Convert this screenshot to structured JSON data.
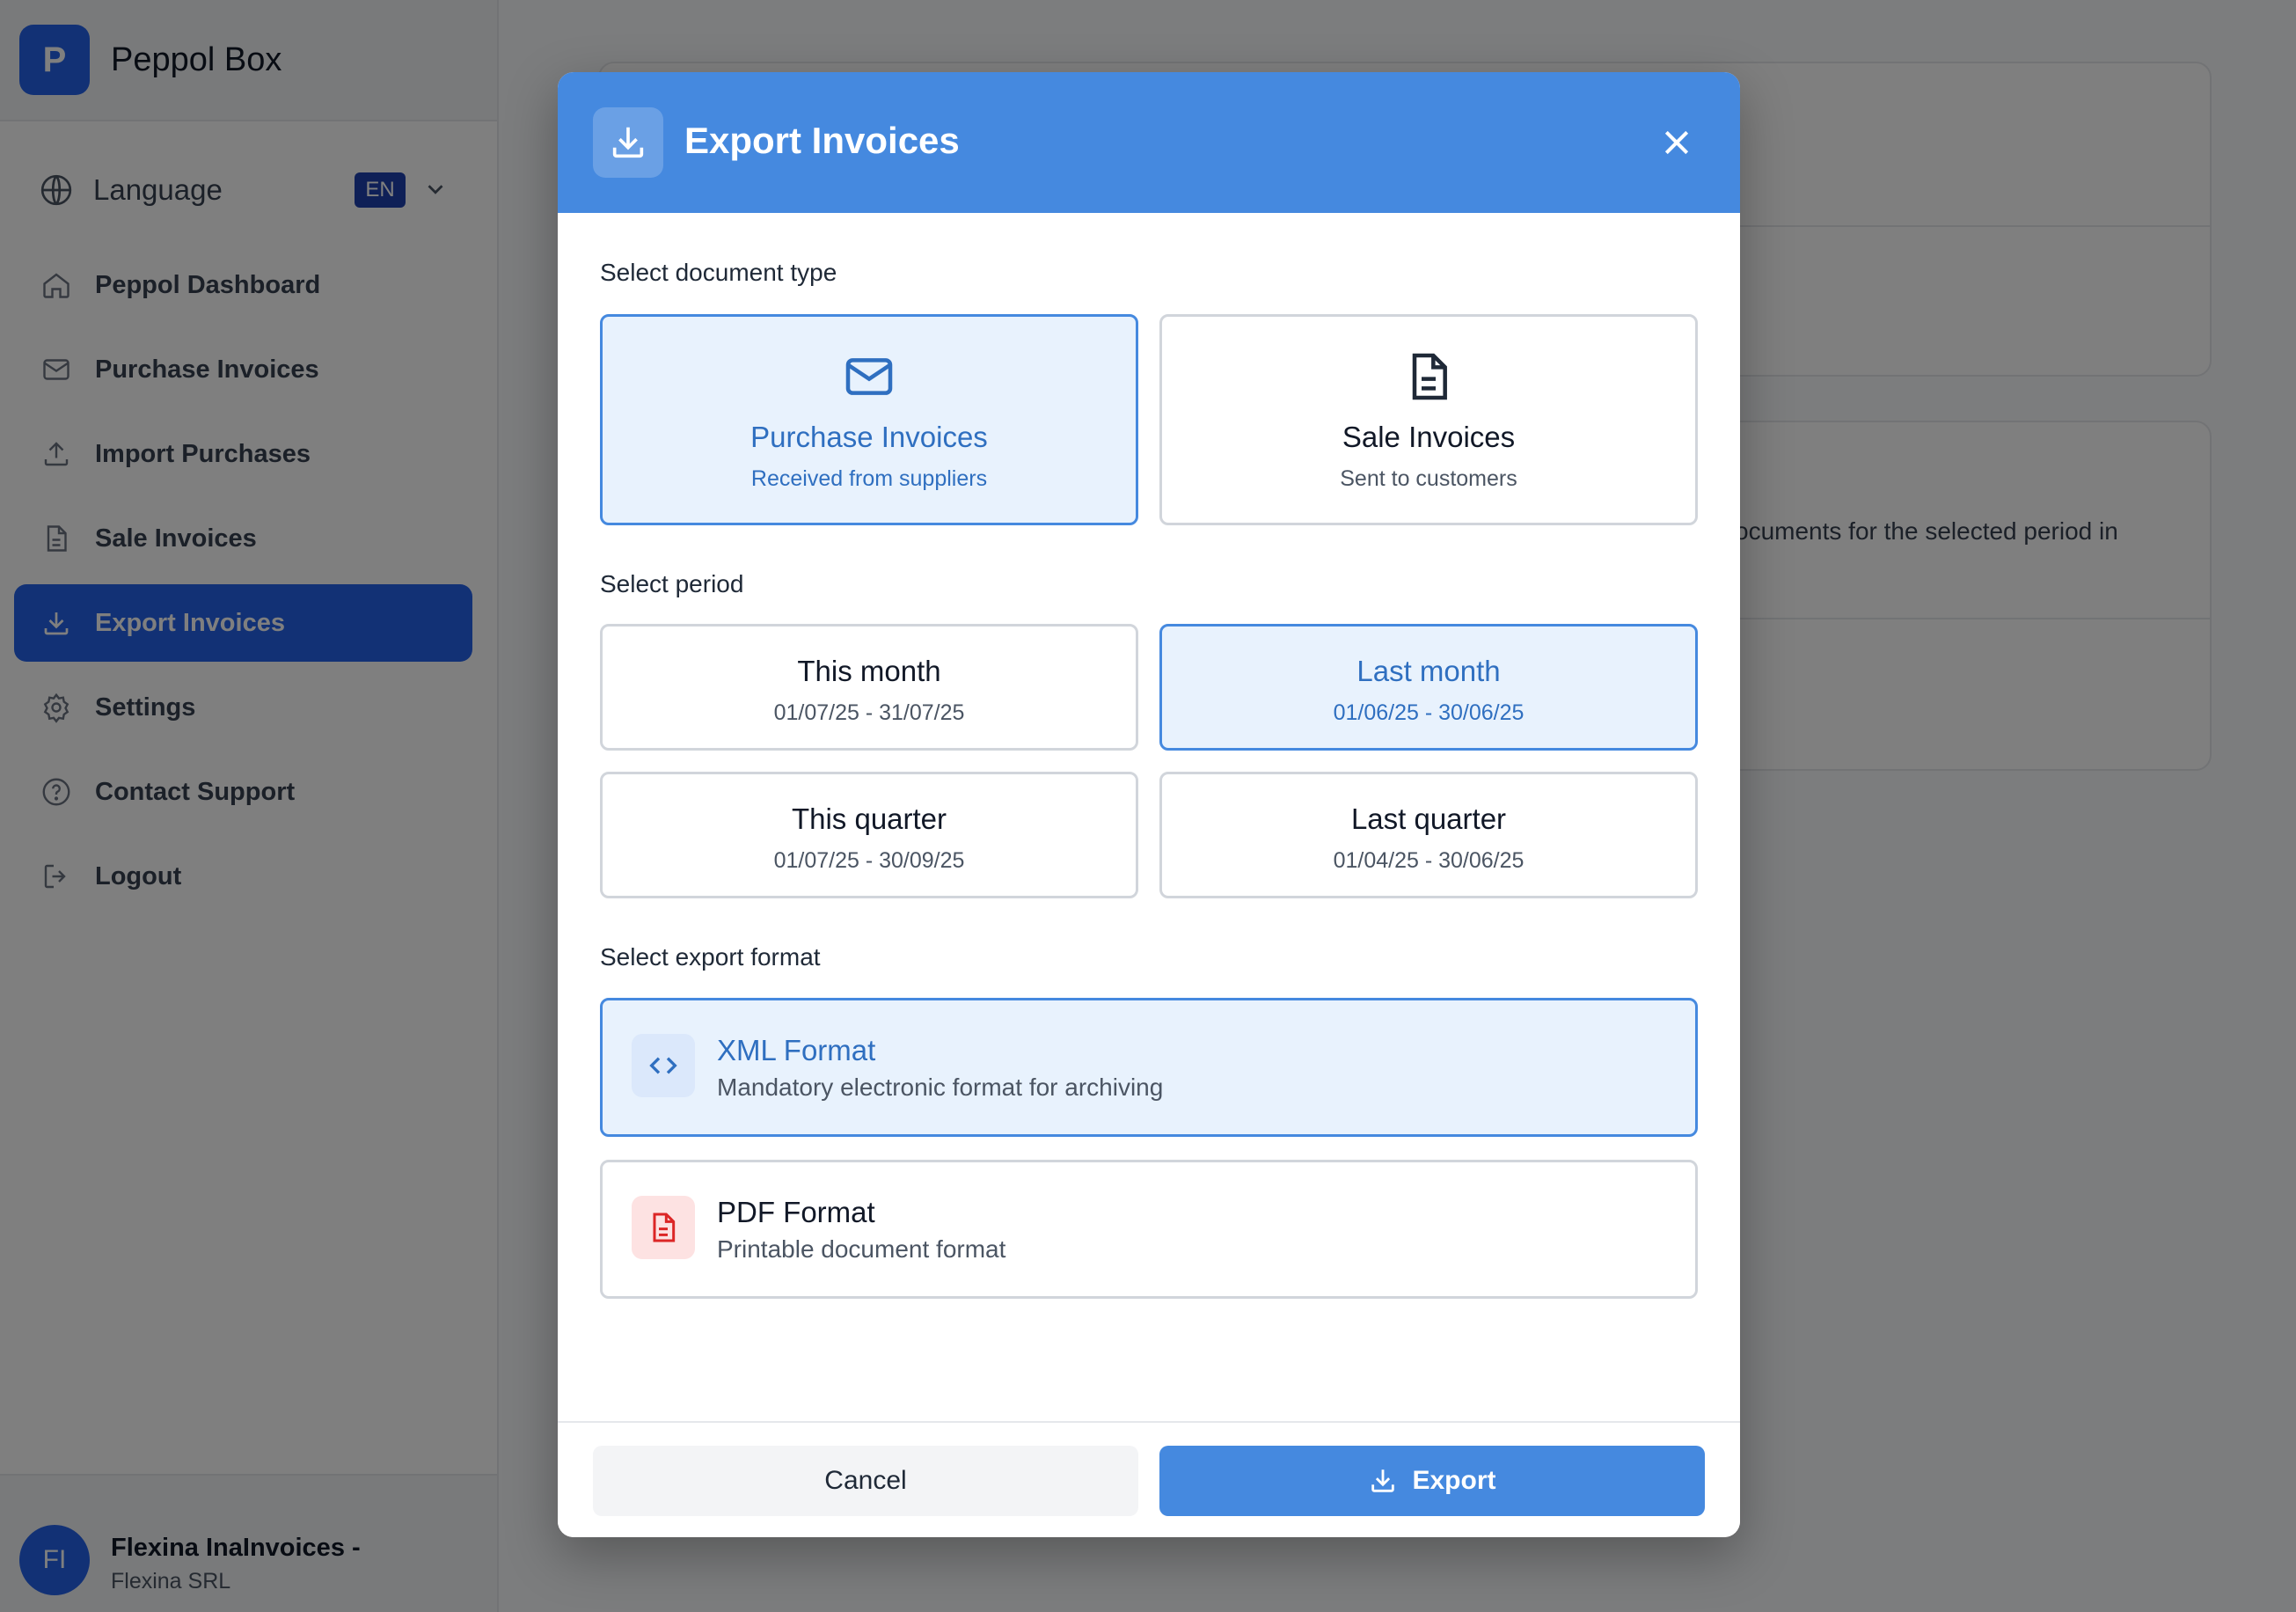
{
  "brand": {
    "logo_letter": "P",
    "name": "Peppol Box"
  },
  "sidebar": {
    "language_label": "Language",
    "language_code": "EN",
    "items": [
      {
        "label": "Peppol Dashboard",
        "icon": "home-icon"
      },
      {
        "label": "Purchase Invoices",
        "icon": "mail-icon"
      },
      {
        "label": "Import Purchases",
        "icon": "upload-icon"
      },
      {
        "label": "Sale Invoices",
        "icon": "document-icon"
      },
      {
        "label": "Export Invoices",
        "icon": "download-icon",
        "active": true
      },
      {
        "label": "Settings",
        "icon": "gear-icon"
      },
      {
        "label": "Contact Support",
        "icon": "help-icon"
      },
      {
        "label": "Logout",
        "icon": "logout-icon"
      }
    ]
  },
  "user": {
    "initials": "FI",
    "name": "Flexina InaInvoices -",
    "company": "Flexina SRL"
  },
  "background": {
    "partial_text": "ocuments for the selected period in"
  },
  "modal": {
    "title": "Export Invoices",
    "document_type": {
      "label": "Select document type",
      "options": [
        {
          "title": "Purchase Invoices",
          "subtitle": "Received from suppliers",
          "icon": "mail-icon",
          "selected": true
        },
        {
          "title": "Sale Invoices",
          "subtitle": "Sent to customers",
          "icon": "document-icon",
          "selected": false
        }
      ]
    },
    "period": {
      "label": "Select period",
      "options": [
        {
          "title": "This month",
          "range": "01/07/25 - 31/07/25",
          "selected": false
        },
        {
          "title": "Last month",
          "range": "01/06/25 - 30/06/25",
          "selected": true
        },
        {
          "title": "This quarter",
          "range": "01/07/25 - 30/09/25",
          "selected": false
        },
        {
          "title": "Last quarter",
          "range": "01/04/25 - 30/06/25",
          "selected": false
        }
      ]
    },
    "format": {
      "label": "Select export format",
      "options": [
        {
          "title": "XML Format",
          "subtitle": "Mandatory electronic format for archiving",
          "icon": "code-icon",
          "selected": true
        },
        {
          "title": "PDF Format",
          "subtitle": "Printable document format",
          "icon": "pdf-file-icon",
          "selected": false
        }
      ]
    },
    "cancel_label": "Cancel",
    "export_label": "Export"
  },
  "colors": {
    "accent": "#4589df",
    "selected_bg": "#e8f2fd",
    "sidebar_active": "#2563eb",
    "pdf_red": "#dc2626"
  }
}
